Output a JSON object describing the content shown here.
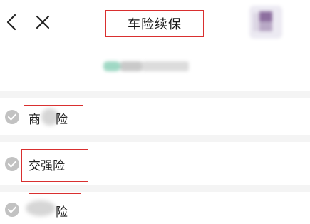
{
  "header": {
    "title": "车险续保",
    "back_icon": "chevron-left-icon",
    "close_icon": "close-icon"
  },
  "options": [
    {
      "label_visible_start": "商",
      "label_visible_end": "险"
    },
    {
      "label": "交强险"
    },
    {
      "label_visible_end": "险"
    }
  ],
  "colors": {
    "highlight_box": "#d92f2f",
    "radio_icon": "#c2c2c2",
    "section_gap": "#f4f4f4"
  }
}
